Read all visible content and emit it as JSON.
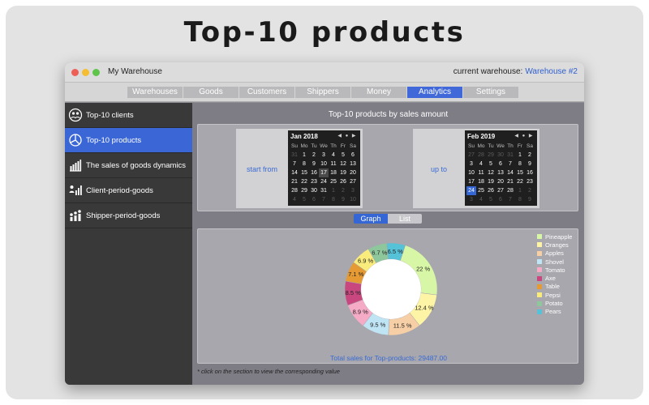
{
  "headline": "Top-10 products",
  "window": {
    "title": "My Warehouse",
    "warehouse_label": "current warehouse:",
    "warehouse_name": "Warehouse #2"
  },
  "tabs": [
    {
      "label": "Warehouses"
    },
    {
      "label": "Goods"
    },
    {
      "label": "Customers"
    },
    {
      "label": "Shippers"
    },
    {
      "label": "Money"
    },
    {
      "label": "Analytics"
    },
    {
      "label": "Settings"
    }
  ],
  "active_tab": "Analytics",
  "sidebar": {
    "items": [
      {
        "label": "Top-10 clients",
        "icon": "globe-people-icon"
      },
      {
        "label": "Top-10 products",
        "icon": "pie-chart-icon"
      },
      {
        "label": "The sales of goods dynamics",
        "icon": "bar-chart-icon"
      },
      {
        "label": "Client-period-goods",
        "icon": "person-chart-icon"
      },
      {
        "label": "Shipper-period-goods",
        "icon": "group-chart-icon"
      }
    ],
    "active": "Top-10 products"
  },
  "main": {
    "title": "Top-10 products by sales amount",
    "start_label": "start from",
    "end_label": "up to",
    "view_graph": "Graph",
    "view_list": "List",
    "total": "Total sales for Top-products: 29487.00",
    "footnote": "* click on the section to view the corresponding value"
  },
  "calendars": {
    "start": {
      "month": "Jan 2018",
      "nav": "◀ ● ▶",
      "dows": [
        "Su",
        "Mo",
        "Tu",
        "We",
        "Th",
        "Fr",
        "Sa"
      ],
      "days": [
        "31",
        "1",
        "2",
        "3",
        "4",
        "5",
        "6",
        "7",
        "8",
        "9",
        "10",
        "11",
        "12",
        "13",
        "14",
        "15",
        "16",
        "17",
        "18",
        "19",
        "20",
        "21",
        "22",
        "23",
        "24",
        "25",
        "26",
        "27",
        "28",
        "29",
        "30",
        "31",
        "1",
        "2",
        "3",
        "4",
        "5",
        "6",
        "7",
        "8",
        "9",
        "10"
      ],
      "muted": [
        0,
        32,
        33,
        34,
        35,
        36,
        37,
        38,
        39,
        40,
        41
      ],
      "selected": -1,
      "today": 17
    },
    "end": {
      "month": "Feb 2019",
      "nav": "◀ ● ▶",
      "dows": [
        "Su",
        "Mo",
        "Tu",
        "We",
        "Th",
        "Fr",
        "Sa"
      ],
      "days": [
        "27",
        "28",
        "29",
        "30",
        "31",
        "1",
        "2",
        "3",
        "4",
        "5",
        "6",
        "7",
        "8",
        "9",
        "10",
        "11",
        "12",
        "13",
        "14",
        "15",
        "16",
        "17",
        "18",
        "19",
        "20",
        "21",
        "22",
        "23",
        "24",
        "25",
        "26",
        "27",
        "28",
        "1",
        "2",
        "3",
        "4",
        "5",
        "6",
        "7",
        "8",
        "9"
      ],
      "muted": [
        0,
        1,
        2,
        3,
        4,
        33,
        34,
        35,
        36,
        37,
        38,
        39,
        40,
        41
      ],
      "selected": 28,
      "today": -1
    }
  },
  "chart_data": {
    "type": "pie",
    "labels": [
      "Pineapple",
      "Oranges",
      "Apples",
      "Shovel",
      "Tomato",
      "Axe",
      "Table",
      "Pepsi",
      "Potato",
      "Pears"
    ],
    "values": [
      22,
      12.4,
      11.5,
      9.5,
      8.9,
      8.5,
      7.1,
      6.9,
      6.7,
      6.5
    ],
    "value_labels": [
      "22 %",
      "12.4 %",
      "11.5 %",
      "9.5 %",
      "8.9 %",
      "8.5 %",
      "7.1 %",
      "6.9 %",
      "6.7 %",
      "6.5 %"
    ],
    "colors": [
      "#d8f7a6",
      "#fdf4a5",
      "#f6cfa6",
      "#bfe4f4",
      "#f5aac6",
      "#c8477e",
      "#e59a34",
      "#f9ec7c",
      "#8ec79b",
      "#56c2d8"
    ],
    "legend_position": "top-right",
    "chart_type_hint": "donut"
  },
  "colors": {
    "accent": "#3b67d6",
    "sidebar_bg": "#393939",
    "link_blue": "#3a6bd4"
  }
}
